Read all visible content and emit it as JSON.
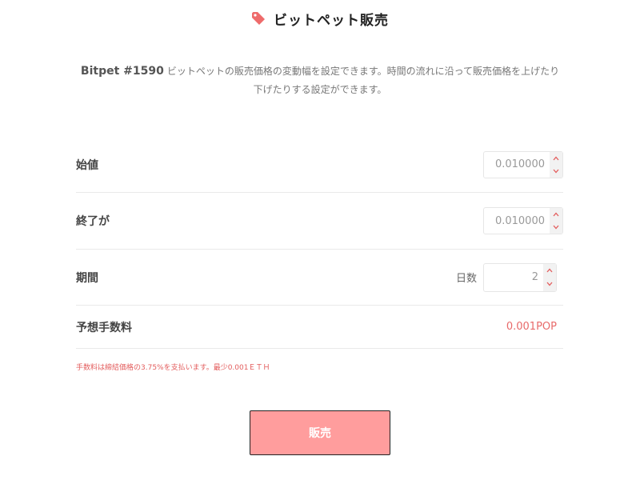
{
  "title": "ビットペット販売",
  "description": {
    "pet_id": "Bitpet #1590",
    "text": "ビットペットの販売価格の変動幅を設定できます。時間の流れに沿って販売価格を上げたり下げたりする設定ができます。"
  },
  "form": {
    "start_price": {
      "label": "始値",
      "placeholder": "0.010000"
    },
    "end_price": {
      "label": "終了が",
      "placeholder": "0.010000"
    },
    "duration": {
      "label": "期間",
      "unit": "日数",
      "value": "2"
    },
    "fee": {
      "label": "予想手数料",
      "value": "0.001POP"
    }
  },
  "note": "手数料は締結価格の3.75%を支払います。最少0.001ＥＴＨ",
  "sell_button_label": "販売",
  "colors": {
    "accent": "#e86a6a",
    "button_bg": "#ff9d9d",
    "spinner_arrow": "#e35d5d"
  },
  "icons": {
    "title": "price-tag-icon",
    "spin_up": "chevron-up-icon",
    "spin_down": "chevron-down-icon"
  }
}
